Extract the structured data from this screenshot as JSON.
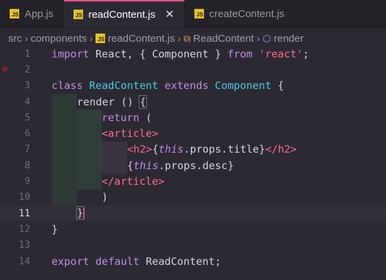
{
  "tabs": [
    {
      "label": "App.js",
      "active": false
    },
    {
      "label": "readContent.js",
      "active": true
    },
    {
      "label": "createContent.js",
      "active": false
    }
  ],
  "breadcrumb": {
    "items": [
      "src",
      "components",
      "readContent.js",
      "ReadContent",
      "render"
    ]
  },
  "badge_text": "JS",
  "colors": {
    "accent": "#ff4f8b",
    "keyword": "#c58ce6",
    "class": "#4ec9e6",
    "string": "#ff6a95"
  },
  "lines": [
    {
      "n": "1"
    },
    {
      "n": "2"
    },
    {
      "n": "3"
    },
    {
      "n": "4"
    },
    {
      "n": "5"
    },
    {
      "n": "6"
    },
    {
      "n": "7"
    },
    {
      "n": "8"
    },
    {
      "n": "9"
    },
    {
      "n": "10"
    },
    {
      "n": "11"
    },
    {
      "n": "12"
    },
    {
      "n": "13"
    },
    {
      "n": "14"
    }
  ],
  "code": {
    "l1": {
      "import": "import",
      "react": "React,",
      "open": "{",
      "component": "Component",
      "close": "}",
      "from": "from",
      "str": "'react'",
      "semi": ";"
    },
    "l3": {
      "class": "class",
      "name": "ReadContent",
      "extends": "extends",
      "base": "Component",
      "brace": "{"
    },
    "l4": {
      "render": "render",
      "parens": "()",
      "brace": "{"
    },
    "l5": {
      "return": "return",
      "paren": "("
    },
    "l6": {
      "lt": "<",
      "tag": "article",
      "gt": ">"
    },
    "l7": {
      "open": "<h2>",
      "lb": "{",
      "this": "this",
      "rest": ".props.title",
      "rb": "}",
      "close": "</h2>"
    },
    "l8": {
      "lb": "{",
      "this": "this",
      "rest": ".props.desc",
      "rb": "}"
    },
    "l9": {
      "lt": "</",
      "tag": "article",
      "gt": ">"
    },
    "l10": {
      "paren": ")"
    },
    "l11": {
      "brace": "}"
    },
    "l12": {
      "brace": "}"
    },
    "l14": {
      "export": "export",
      "default": "default",
      "name": "ReadContent",
      "semi": ";"
    }
  }
}
